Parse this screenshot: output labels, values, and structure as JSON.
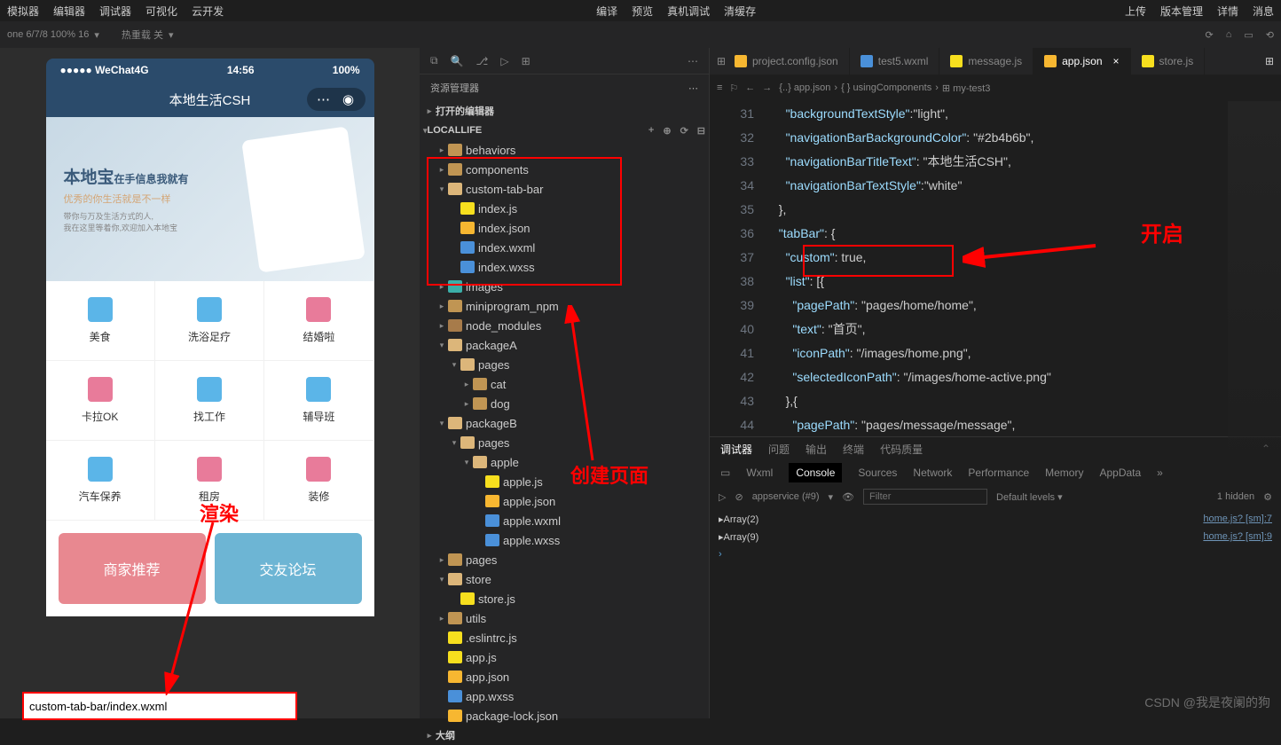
{
  "menu": {
    "left": [
      "模拟器",
      "编辑器",
      "调试器",
      "可视化",
      "云开发"
    ],
    "center": [
      "编译",
      "预览",
      "真机调试",
      "清缓存"
    ],
    "right": [
      "上传",
      "版本管理",
      "详情",
      "消息"
    ]
  },
  "toolbar": {
    "device": "one 6/7/8 100% 16",
    "reload": "热重载 关",
    "explorer_title": "资源管理器",
    "opened_editors": "打开的编辑器",
    "project": "LOCALLIFE",
    "outline": "大纲"
  },
  "phone": {
    "carrier": "●●●●● WeChat4G",
    "time": "14:56",
    "battery": "100%",
    "title": "本地生活CSH",
    "banner": {
      "h": "本地宝",
      "sub": "在手信息我就有",
      "tag": "优秀的你生活就是不一样",
      "small1": "带你与万及生活方式的人,",
      "small2": "我在这里等着你,欢迎加入本地宝"
    },
    "grid": [
      "美食",
      "洗浴足疗",
      "结婚啦",
      "卡拉OK",
      "找工作",
      "辅导班",
      "汽车保养",
      "租房",
      "装修"
    ],
    "tabs": [
      "商家推荐",
      "交友论坛"
    ]
  },
  "annotations": {
    "render": "渲染",
    "create": "创建页面",
    "open": "开启",
    "path": "custom-tab-bar/index.wxml"
  },
  "tree": [
    {
      "d": 0,
      "t": "folder",
      "l": "behaviors",
      "c": "▸"
    },
    {
      "d": 0,
      "t": "folder",
      "l": "components",
      "c": "▸"
    },
    {
      "d": 0,
      "t": "folder-open",
      "l": "custom-tab-bar",
      "c": "▾"
    },
    {
      "d": 1,
      "t": "js",
      "l": "index.js"
    },
    {
      "d": 1,
      "t": "json",
      "l": "index.json"
    },
    {
      "d": 1,
      "t": "wxml",
      "l": "index.wxml"
    },
    {
      "d": 1,
      "t": "wxss",
      "l": "index.wxss"
    },
    {
      "d": 0,
      "t": "img",
      "l": "images",
      "c": "▸"
    },
    {
      "d": 0,
      "t": "folder",
      "l": "miniprogram_npm",
      "c": "▸"
    },
    {
      "d": 0,
      "t": "db",
      "l": "node_modules",
      "c": "▸"
    },
    {
      "d": 0,
      "t": "folder-open",
      "l": "packageA",
      "c": "▾"
    },
    {
      "d": 1,
      "t": "folder-open",
      "l": "pages",
      "c": "▾"
    },
    {
      "d": 2,
      "t": "folder",
      "l": "cat",
      "c": "▸"
    },
    {
      "d": 2,
      "t": "folder",
      "l": "dog",
      "c": "▸"
    },
    {
      "d": 0,
      "t": "folder-open",
      "l": "packageB",
      "c": "▾"
    },
    {
      "d": 1,
      "t": "folder-open",
      "l": "pages",
      "c": "▾"
    },
    {
      "d": 2,
      "t": "folder-open",
      "l": "apple",
      "c": "▾"
    },
    {
      "d": 3,
      "t": "js",
      "l": "apple.js"
    },
    {
      "d": 3,
      "t": "json",
      "l": "apple.json"
    },
    {
      "d": 3,
      "t": "wxml",
      "l": "apple.wxml"
    },
    {
      "d": 3,
      "t": "wxss",
      "l": "apple.wxss"
    },
    {
      "d": 0,
      "t": "folder",
      "l": "pages",
      "c": "▸"
    },
    {
      "d": 0,
      "t": "folder-open",
      "l": "store",
      "c": "▾"
    },
    {
      "d": 1,
      "t": "js",
      "l": "store.js"
    },
    {
      "d": 0,
      "t": "folder",
      "l": "utils",
      "c": "▸"
    },
    {
      "d": 0,
      "t": "js",
      "l": ".eslintrc.js"
    },
    {
      "d": 0,
      "t": "js",
      "l": "app.js"
    },
    {
      "d": 0,
      "t": "json",
      "l": "app.json"
    },
    {
      "d": 0,
      "t": "wxss",
      "l": "app.wxss"
    },
    {
      "d": 0,
      "t": "json",
      "l": "package-lock.json"
    }
  ],
  "tabs": [
    {
      "icon": "json",
      "l": "project.config.json"
    },
    {
      "icon": "wxml",
      "l": "test5.wxml"
    },
    {
      "icon": "js",
      "l": "message.js"
    },
    {
      "icon": "json",
      "l": "app.json",
      "active": true
    },
    {
      "icon": "js",
      "l": "store.js"
    }
  ],
  "breadcrumb": [
    "{..} app.json",
    "{ } usingComponents",
    "⊞ my-test3"
  ],
  "code": [
    {
      "n": 31,
      "t": "    \"backgroundTextStyle\":\"light\","
    },
    {
      "n": 32,
      "t": "    \"navigationBarBackgroundColor\": \"#2b4b6b\","
    },
    {
      "n": 33,
      "t": "    \"navigationBarTitleText\": \"本地生活CSH\","
    },
    {
      "n": 34,
      "t": "    \"navigationBarTextStyle\":\"white\""
    },
    {
      "n": 35,
      "t": "  },"
    },
    {
      "n": 36,
      "t": "  \"tabBar\": {"
    },
    {
      "n": 37,
      "t": "    \"custom\": true,"
    },
    {
      "n": 38,
      "t": "    \"list\": [{"
    },
    {
      "n": 39,
      "t": "      \"pagePath\": \"pages/home/home\","
    },
    {
      "n": 40,
      "t": "      \"text\": \"首页\","
    },
    {
      "n": 41,
      "t": "      \"iconPath\": \"/images/home.png\","
    },
    {
      "n": 42,
      "t": "      \"selectedIconPath\": \"/images/home-active.png\""
    },
    {
      "n": 43,
      "t": "    },{"
    },
    {
      "n": 44,
      "t": "      \"pagePath\": \"pages/message/message\","
    }
  ],
  "debug": {
    "tabs": [
      "调试器",
      "问题",
      "输出",
      "终端",
      "代码质量"
    ],
    "devtabs": [
      "Wxml",
      "Console",
      "Sources",
      "Network",
      "Performance",
      "Memory",
      "AppData"
    ],
    "context": "appservice (#9)",
    "filter_ph": "Filter",
    "levels": "Default levels ▾",
    "hidden": "1 hidden",
    "rows": [
      {
        "l": "▸Array(2)",
        "r": "home.js? [sm]:7"
      },
      {
        "l": "▸Array(9)",
        "r": "home.js? [sm]:9"
      }
    ]
  },
  "watermark": "CSDN @我是夜阑的狗"
}
